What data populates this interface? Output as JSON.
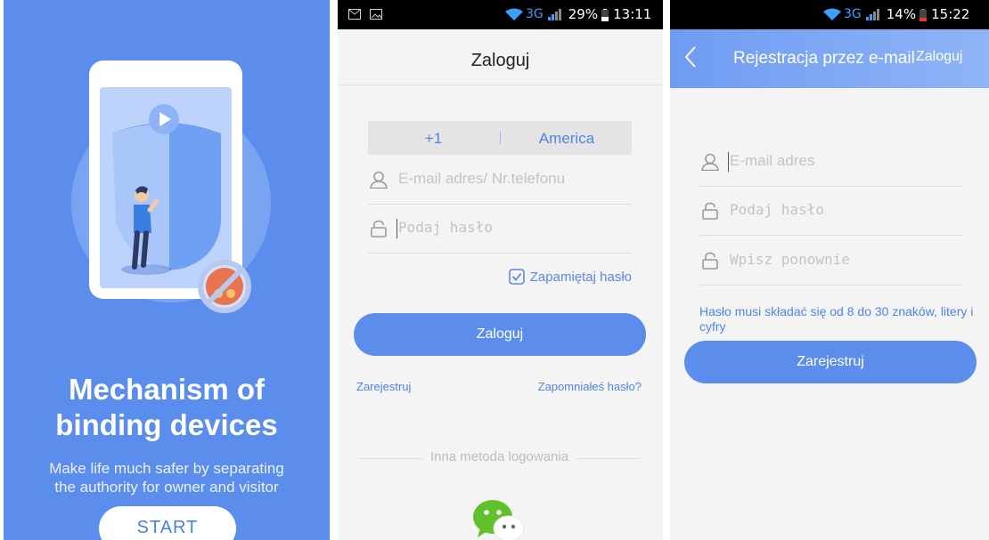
{
  "onboarding": {
    "headline_line1": "Mechanism of",
    "headline_line2": "binding devices",
    "subtitle_line1": "Make life much safer by separating",
    "subtitle_line2": "the authority for owner and visitor",
    "start_label": "START",
    "colors": {
      "background": "#5b8ded",
      "button_text": "#4a7fe6"
    }
  },
  "login": {
    "status": {
      "network": "3G",
      "battery": "29%",
      "time": "13:11"
    },
    "title": "Zaloguj",
    "country_code": "+1",
    "country_name": "America",
    "account_placeholder": "E-mail adres/ Nr.telefonu",
    "password_placeholder": "Podaj hasło",
    "remember_label": "Zapamiętaj hasło",
    "remember_checked": true,
    "login_button": "Zaloguj",
    "register_link": "Zarejestruj",
    "forgot_link": "Zapomniałeś hasło?",
    "other_method": "Inna metoda logowania",
    "icons": [
      "user-icon",
      "lock-icon",
      "checkbox-icon",
      "wechat-icon"
    ]
  },
  "register": {
    "status": {
      "network": "3G",
      "battery": "14%",
      "time": "15:22"
    },
    "title": "Rejestracja przez e-mail",
    "login_link": "Zaloguj",
    "email_placeholder": "E-mail adres",
    "password_placeholder": "Podaj hasło",
    "repeat_placeholder": "Wpisz ponownie",
    "hint": "Hasło musi składać się od 8 do 30 znaków, litery i cyfry",
    "register_button": "Zarejestruj",
    "colors": {
      "accent": "#5b8ded",
      "battery_low": "#e53935"
    }
  }
}
